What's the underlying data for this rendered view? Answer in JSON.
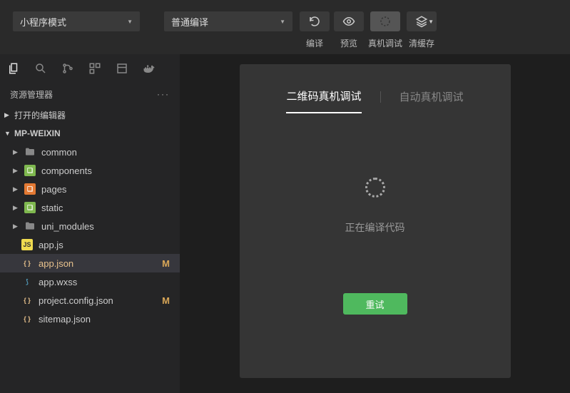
{
  "toolbar": {
    "mode_dropdown": "小程序模式",
    "compile_dropdown": "普通编译",
    "compile_label": "编译",
    "preview_label": "预览",
    "debug_label": "真机调试",
    "clear_label": "清缓存"
  },
  "explorer": {
    "title": "资源管理器",
    "open_editors": "打开的编辑器",
    "project_name": "MP-WEIXIN",
    "items": [
      {
        "type": "folder",
        "name": "common",
        "icon": "folder"
      },
      {
        "type": "folder",
        "name": "components",
        "icon": "green"
      },
      {
        "type": "folder",
        "name": "pages",
        "icon": "orange"
      },
      {
        "type": "folder",
        "name": "static",
        "icon": "green"
      },
      {
        "type": "folder",
        "name": "uni_modules",
        "icon": "folder"
      },
      {
        "type": "file",
        "name": "app.js",
        "icon": "js"
      },
      {
        "type": "file",
        "name": "app.json",
        "icon": "json",
        "modified": true,
        "selected": true
      },
      {
        "type": "file",
        "name": "app.wxss",
        "icon": "wxss"
      },
      {
        "type": "file",
        "name": "project.config.json",
        "icon": "json",
        "modified": true
      },
      {
        "type": "file",
        "name": "sitemap.json",
        "icon": "json"
      }
    ],
    "modified_badge": "M"
  },
  "panel": {
    "tabs": {
      "qr_debug": "二维码真机调试",
      "auto_debug": "自动真机调试"
    },
    "status": "正在编译代码",
    "retry": "重试"
  }
}
